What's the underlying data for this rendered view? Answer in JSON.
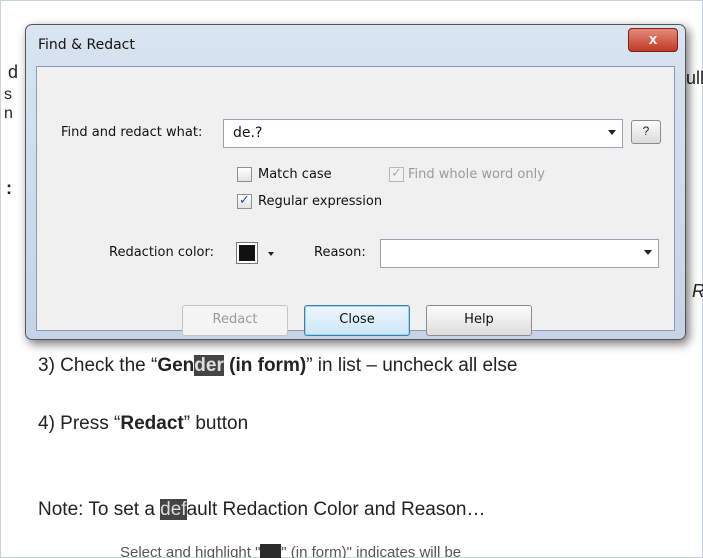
{
  "background_doc": {
    "left_fragments": [
      "d",
      "s",
      "n",
      ":"
    ],
    "right_fragments": [
      "ull",
      "R"
    ],
    "step3": {
      "prefix": "3)  Check the “",
      "bold1": "Gen",
      "bold_hl": "der",
      "bold2": " (in form)",
      "suffix": "” in list – uncheck all else"
    },
    "step4": {
      "prefix": "4)  Press “",
      "bold": "Redact",
      "suffix": "” button"
    },
    "note": {
      "prefix": "Note: To set a ",
      "hl": "def",
      "suffix": "ault Redaction Color and Reason…"
    },
    "cut_line": {
      "prefix": "Select and highlight \"",
      "hl": "def",
      "suffix": "\" (in form)\" indicates will be"
    }
  },
  "dialog": {
    "title": "Find & Redact",
    "close_glyph": "x",
    "find_label": "Find and redact what:",
    "find_value": "de.?",
    "help_q": "?",
    "match_case": {
      "label": "Match case",
      "checked": false
    },
    "whole_word": {
      "label": "Find whole word only",
      "checked": true,
      "disabled": true
    },
    "regex": {
      "label": "Regular expression",
      "checked": true
    },
    "color_label": "Redaction color:",
    "color_value": "#111111",
    "reason_label": "Reason:",
    "reason_value": "",
    "buttons": {
      "redact": "Redact",
      "close": "Close",
      "help": "Help"
    },
    "check_glyph": "✓"
  }
}
